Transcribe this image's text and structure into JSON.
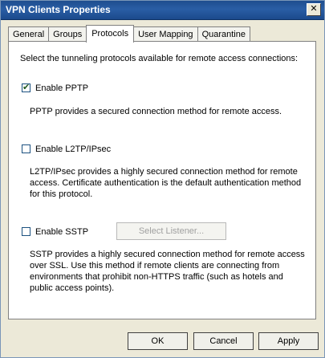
{
  "window": {
    "title": "VPN Clients Properties",
    "close_glyph": "✕"
  },
  "tabs": [
    {
      "label": "General",
      "active": false
    },
    {
      "label": "Groups",
      "active": false
    },
    {
      "label": "Protocols",
      "active": true
    },
    {
      "label": "User Mapping",
      "active": false
    },
    {
      "label": "Quarantine",
      "active": false
    }
  ],
  "protocols": {
    "intro": "Select the tunneling protocols available for remote access connections:",
    "pptp": {
      "label": "Enable PPTP",
      "checked": true,
      "description": "PPTP provides a secured connection method for remote access."
    },
    "l2tp": {
      "label": "Enable L2TP/IPsec",
      "checked": false,
      "description_lines": [
        "L2TP/IPsec provides a highly secured connection method for remote",
        "access. Certificate authentication is the default authentication method",
        "for this protocol."
      ]
    },
    "sstp": {
      "label": "Enable SSTP",
      "checked": false,
      "listener_button": "Select Listener...",
      "description_lines": [
        "SSTP provides a highly secured connection method for remote access",
        "over SSL. Use this method if remote clients are connecting from",
        "environments that prohibit non-HTTPS traffic (such as hotels and",
        "public access points)."
      ]
    }
  },
  "buttons": {
    "ok": "OK",
    "cancel": "Cancel",
    "apply": "Apply"
  },
  "check_glyph": "✔"
}
